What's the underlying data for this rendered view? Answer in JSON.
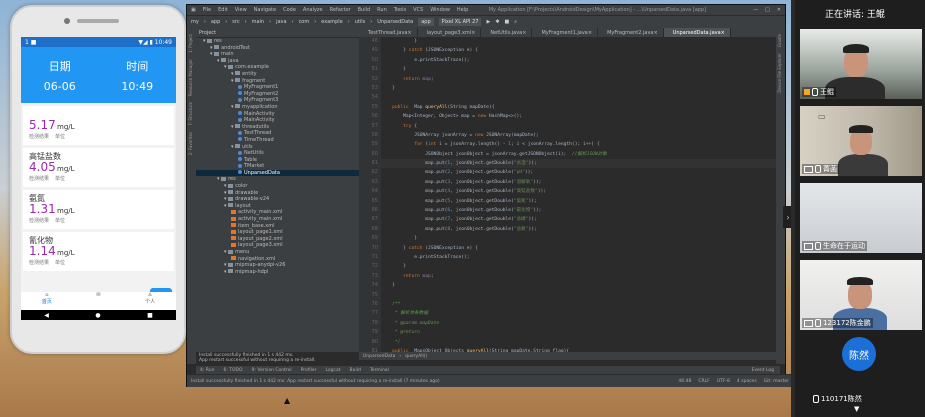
{
  "phone": {
    "status_left": "1 ■",
    "status_right": "▼◢ ▮ 10:49",
    "header": {
      "date_label": "日期",
      "time_label": "时间",
      "date_value": "06-06",
      "time_value": "10:49"
    },
    "cards": [
      {
        "title": "",
        "value": "5.17",
        "unit": "mg/L",
        "sub_a": "检测结果",
        "sub_b": "单位"
      },
      {
        "title": "高锰盐数",
        "value": "4.05",
        "unit": "mg/L",
        "sub_a": "检测结果",
        "sub_b": "单位"
      },
      {
        "title": "氨氮",
        "value": "1.31",
        "unit": "mg/L",
        "sub_a": "检测结果",
        "sub_b": "单位"
      },
      {
        "title": "氰化物",
        "value": "1.14",
        "unit": "mg/L",
        "sub_a": "检测结果",
        "sub_b": "单位"
      }
    ],
    "refresh_label": "更新",
    "nav": [
      {
        "label": "首页"
      },
      {
        "label": ""
      },
      {
        "label": "个人"
      }
    ],
    "sysnav": [
      "◀",
      "●",
      "■"
    ],
    "accent": "#2196f3"
  },
  "ide": {
    "menu": [
      "File",
      "Edit",
      "View",
      "Navigate",
      "Code",
      "Analyze",
      "Refactor",
      "Build",
      "Run",
      "Tools",
      "VCS",
      "Window",
      "Help"
    ],
    "title_path": "My Application [F:\\Projects\\AndroidDesign\\MyApplication] - ...\\UnparsedData.java [app]",
    "toolbar": [
      "my",
      "app",
      "src",
      "main",
      "java",
      "com",
      "example",
      "utils",
      "UnparsedData"
    ],
    "run_config": "app",
    "device": "Pixel XL API 27",
    "project_header": "Project",
    "tree": [
      {
        "depth": 1,
        "type": "folder",
        "label": "res"
      },
      {
        "depth": 2,
        "type": "folder",
        "label": "androidTest"
      },
      {
        "depth": 2,
        "type": "folder",
        "label": "main"
      },
      {
        "depth": 3,
        "type": "folder",
        "label": "java"
      },
      {
        "depth": 4,
        "type": "folder",
        "label": "com.example"
      },
      {
        "depth": 5,
        "type": "folder",
        "label": "entity"
      },
      {
        "depth": 5,
        "type": "folder",
        "label": "fragment"
      },
      {
        "depth": 6,
        "type": "java",
        "label": "MyFragment1"
      },
      {
        "depth": 6,
        "type": "java",
        "label": "MyFragment2"
      },
      {
        "depth": 6,
        "type": "java",
        "label": "MyFragment3"
      },
      {
        "depth": 5,
        "type": "folder",
        "label": "myapplication"
      },
      {
        "depth": 6,
        "type": "java",
        "label": "MainActivity"
      },
      {
        "depth": 6,
        "type": "java",
        "label": "MainActivity"
      },
      {
        "depth": 5,
        "type": "folder",
        "label": "threadutils"
      },
      {
        "depth": 6,
        "type": "java",
        "label": "TestThread"
      },
      {
        "depth": 6,
        "type": "java",
        "label": "TimeThread"
      },
      {
        "depth": 5,
        "type": "folder",
        "label": "utils"
      },
      {
        "depth": 6,
        "type": "java",
        "label": "NetUtils"
      },
      {
        "depth": 6,
        "type": "java",
        "label": "Table"
      },
      {
        "depth": 6,
        "type": "java",
        "label": "TMarket"
      },
      {
        "depth": 6,
        "type": "java",
        "label": "UnparsedData",
        "selected": true
      },
      {
        "depth": 3,
        "type": "folder",
        "label": "res"
      },
      {
        "depth": 4,
        "type": "folder",
        "label": "color"
      },
      {
        "depth": 4,
        "type": "folder",
        "label": "drawable"
      },
      {
        "depth": 4,
        "type": "folder",
        "label": "drawable-v24"
      },
      {
        "depth": 4,
        "type": "folder",
        "label": "layout"
      },
      {
        "depth": 5,
        "type": "xml",
        "label": "activity_main.xml"
      },
      {
        "depth": 5,
        "type": "xml",
        "label": "activity_main.xml"
      },
      {
        "depth": 5,
        "type": "xml",
        "label": "item_base.xml"
      },
      {
        "depth": 5,
        "type": "xml",
        "label": "layout_page1.xml"
      },
      {
        "depth": 5,
        "type": "xml",
        "label": "layout_page2.xml"
      },
      {
        "depth": 5,
        "type": "xml",
        "label": "layout_page3.xml"
      },
      {
        "depth": 4,
        "type": "folder",
        "label": "menu"
      },
      {
        "depth": 5,
        "type": "xml",
        "label": "navigation.xml"
      },
      {
        "depth": 4,
        "type": "folder",
        "label": "mipmap-anydpi-v26"
      },
      {
        "depth": 4,
        "type": "folder",
        "label": "mipmap-hdpi"
      }
    ],
    "log": [
      "Install successfully finished in 1 s 442 ms.",
      "App restart successful without requiring a re-install."
    ],
    "tabs": [
      {
        "label": "TestThread.java",
        "active": false
      },
      {
        "label": "layout_page3.xml",
        "active": false
      },
      {
        "label": "NetUtils.java",
        "active": false
      },
      {
        "label": "MyFragment1.java",
        "active": false
      },
      {
        "label": "MyFragment2.java",
        "active": false
      },
      {
        "label": "UnparsedData.java",
        "active": true
      }
    ],
    "gutter_start": 48,
    "breadcrumb": [
      "UnparsedData",
      "queryAll()"
    ],
    "bottom_tools": [
      "4: Run",
      "6: TODO",
      "9: Version Control",
      "Profiler",
      "Logcat",
      "Build",
      "Terminal"
    ],
    "event_log": "Event Log",
    "status": "Install successfully finished in 1 s 442 ms: App restart successful without requiring a re-install (7 minutes ago)",
    "status_right": [
      "46:48",
      "CRLF",
      "UTF-8",
      "4 spaces",
      "Git: master"
    ]
  },
  "call": {
    "speaking": "正在讲话: 王鲲",
    "participants": [
      {
        "name": "王鲲",
        "has_camera": true,
        "owner": true
      },
      {
        "name": "菁菡",
        "has_camera": true
      },
      {
        "name": "生命在于运动",
        "has_camera": true
      },
      {
        "name": "123172陈金鹏",
        "has_camera": true
      },
      {
        "name": "110171陈然",
        "has_camera": false,
        "avatar_text": "陈然"
      }
    ]
  }
}
